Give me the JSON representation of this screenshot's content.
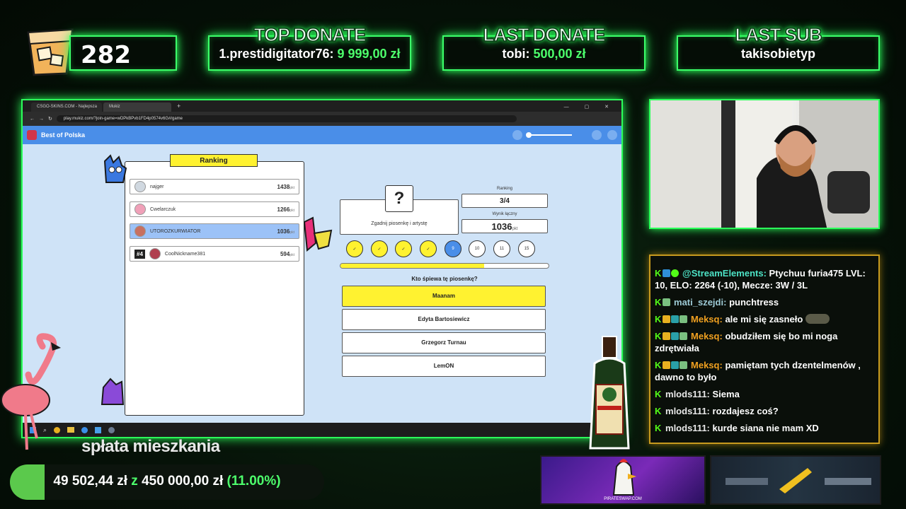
{
  "overlay": {
    "counter": "282",
    "top_donate": {
      "title": "TOP DONATE",
      "name": "1.prestidigitator76:",
      "amount": "9 999,00 zł"
    },
    "last_donate": {
      "title": "LAST DONATE",
      "name": "tobi:",
      "amount": "500,00 zł"
    },
    "last_sub": {
      "title": "LAST SUB",
      "name": "takisobietyp"
    },
    "goal": {
      "title": "spłata mieszkania",
      "current": "49 502,44 zł",
      "sep": "z",
      "target": "450 000,00 zł",
      "percent": "(11.00%)",
      "fraction": 0.11
    },
    "ad_left": "PIRATESWAP.COM",
    "colors": {
      "neon": "#3cff6a",
      "gold": "#c79a1e",
      "kick": "#53fc18"
    }
  },
  "browser": {
    "tabs": [
      "CSGO-SKINS.COM - Najlepsza",
      "Mukiz"
    ],
    "url": "play.mukiz.com/?join-game=wDPkBPvb1FD4p0574v6G#/game",
    "app_title": "Best of Polska"
  },
  "game": {
    "ranking_title": "Ranking",
    "players": [
      {
        "name": "najger",
        "points": "1438",
        "unit": "pkt"
      },
      {
        "name": "Cwelarczuk",
        "points": "1266",
        "unit": "pkt"
      },
      {
        "name": "UTOROZKURWIATOR",
        "points": "1036",
        "unit": "pkt"
      },
      {
        "rank": "#4",
        "name": "CoolNickname381",
        "points": "594",
        "unit": "pkt"
      }
    ],
    "question_mark": "?",
    "task": "Zgadnij piosenkę i artystę",
    "ranking_label": "Ranking",
    "ranking_value": "3/4",
    "score_label": "Wynik łączny",
    "score_value": "1036",
    "score_unit": "pkt",
    "rounds": [
      "✓",
      "✓",
      "✓",
      "✓",
      "9",
      "10",
      "11",
      "15"
    ],
    "progress": 0.69,
    "question": "Kto śpiewa tę piosenkę?",
    "answers": [
      "Maanam",
      "Edyta Bartosiewicz",
      "Grzegorz Turnau",
      "LemON"
    ]
  },
  "chat": [
    {
      "user": "@StreamElements:",
      "color": "#4de3c6",
      "text": "Ptychuu furia475 LVL: 10, ELO: 2264 (-10), Mecze: 3W / 3L"
    },
    {
      "user": "mati_szejdi:",
      "color": "#9ecbd6",
      "text": "punchtress"
    },
    {
      "user": "Meksq:",
      "color": "#f0a020",
      "text": "ale mi się zasneło"
    },
    {
      "user": "Meksq:",
      "color": "#f0a020",
      "text": "obudziłem się bo mi noga zdrętwiała"
    },
    {
      "user": "Meksq:",
      "color": "#f0a020",
      "text": "pamiętam tych dzentelmenów , dawno to było"
    },
    {
      "user": "mlods111:",
      "color": "#e8e8e8",
      "text": "Siema"
    },
    {
      "user": "mlods111:",
      "color": "#e8e8e8",
      "text": "rozdajesz coś?"
    },
    {
      "user": "mlods111:",
      "color": "#e8e8e8",
      "text": "kurde siana nie mam XD"
    }
  ]
}
